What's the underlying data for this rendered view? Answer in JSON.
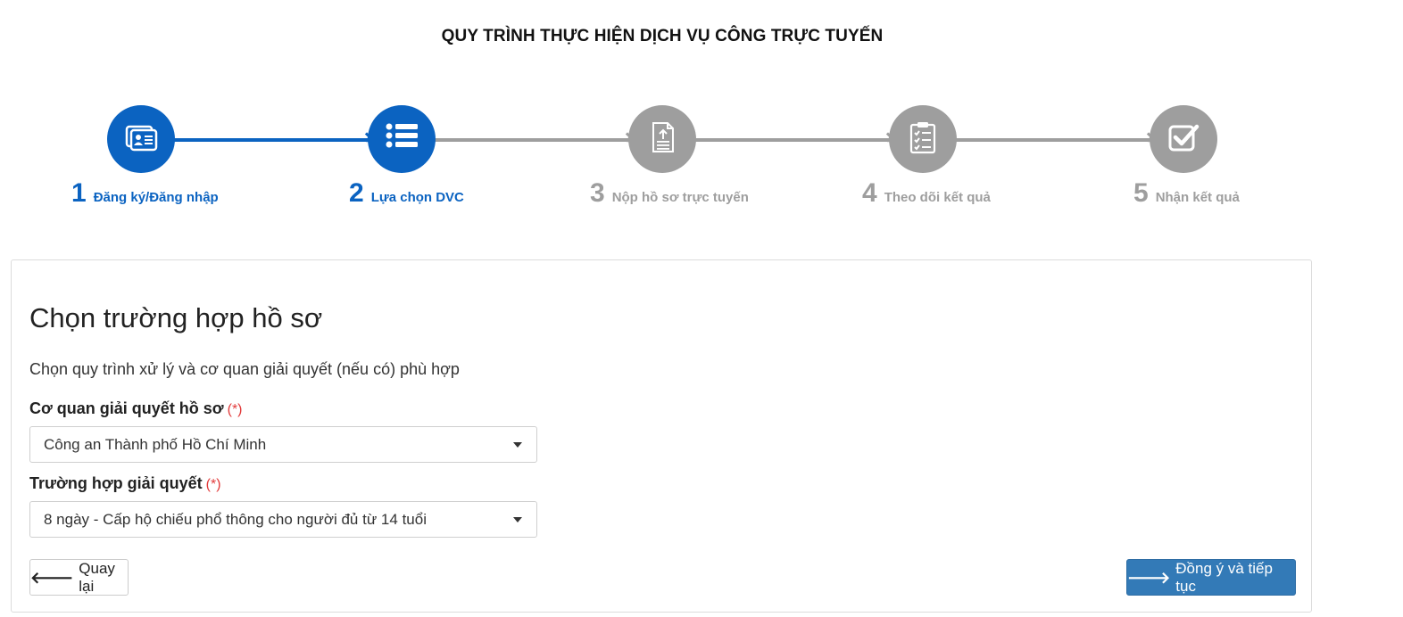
{
  "page_title": "QUY TRÌNH THỰC HIỆN DỊCH VỤ CÔNG TRỰC TUYẾN",
  "colors": {
    "active": "#0b63c1",
    "inactive": "#9e9e9e",
    "primary_button": "#337ab7",
    "required": "#e23b3b"
  },
  "steps": [
    {
      "number": "1",
      "label": "Đăng ký/Đăng nhập",
      "icon": "id-card-icon",
      "state": "active"
    },
    {
      "number": "2",
      "label": "Lựa chọn DVC",
      "icon": "list-icon",
      "state": "active"
    },
    {
      "number": "3",
      "label": "Nộp hồ sơ trực tuyến",
      "icon": "document-upload-icon",
      "state": "inactive"
    },
    {
      "number": "4",
      "label": "Theo dõi kết quả",
      "icon": "clipboard-checklist-icon",
      "state": "inactive"
    },
    {
      "number": "5",
      "label": "Nhận kết quả",
      "icon": "checkbox-checked-icon",
      "state": "inactive"
    }
  ],
  "panel": {
    "heading": "Chọn trường hợp hồ sơ",
    "description": "Chọn quy trình xử lý và cơ quan giải quyết (nếu có) phù hợp",
    "agency": {
      "label": "Cơ quan giải quyết hồ sơ",
      "required_mark": "(*)",
      "selected": "Công an Thành phố Hồ Chí Minh"
    },
    "case": {
      "label": "Trường hợp giải quyết",
      "required_mark": "(*)",
      "selected": "8 ngày - Cấp hộ chiếu phổ thông cho người đủ từ 14 tuổi"
    },
    "back_button": "Quay lại",
    "next_button": "Đồng ý và tiếp tục"
  }
}
